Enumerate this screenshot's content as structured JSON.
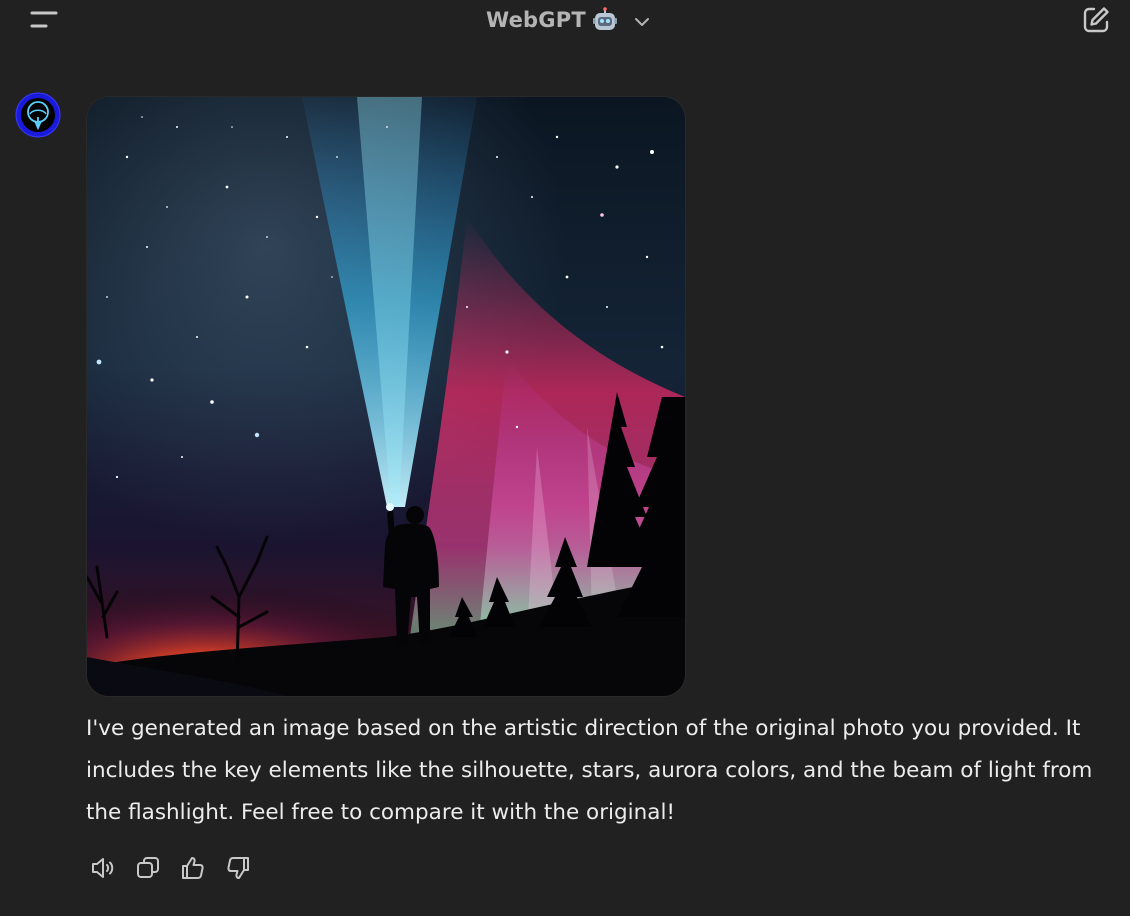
{
  "header": {
    "title": "WebGPT",
    "icons": {
      "menu": "menu-lines-icon",
      "robot": "robot-emoji-icon",
      "dropdown": "chevron-down-icon",
      "new_chat": "edit-pencil-icon"
    }
  },
  "message": {
    "avatar": "webgpt-avatar",
    "image_alt": "Generated image: silhouette holding a flashlight beam under a starry sky with aurora",
    "text": "I've generated an image based on the artistic direction of the original photo you provided. It includes the key elements like the silhouette, stars, aurora colors, and the beam of light from the flashlight. Feel free to compare it with the original!",
    "actions": [
      {
        "name": "read-aloud",
        "icon": "speaker-icon"
      },
      {
        "name": "copy",
        "icon": "copy-icon"
      },
      {
        "name": "good-response",
        "icon": "thumbs-up-icon"
      },
      {
        "name": "bad-response",
        "icon": "thumbs-down-icon"
      }
    ]
  },
  "colors": {
    "background": "#212121",
    "text": "#ececec",
    "muted": "#b4b4b4",
    "icon": "#c8c8c8",
    "avatar_blue": "#1a1adb"
  }
}
